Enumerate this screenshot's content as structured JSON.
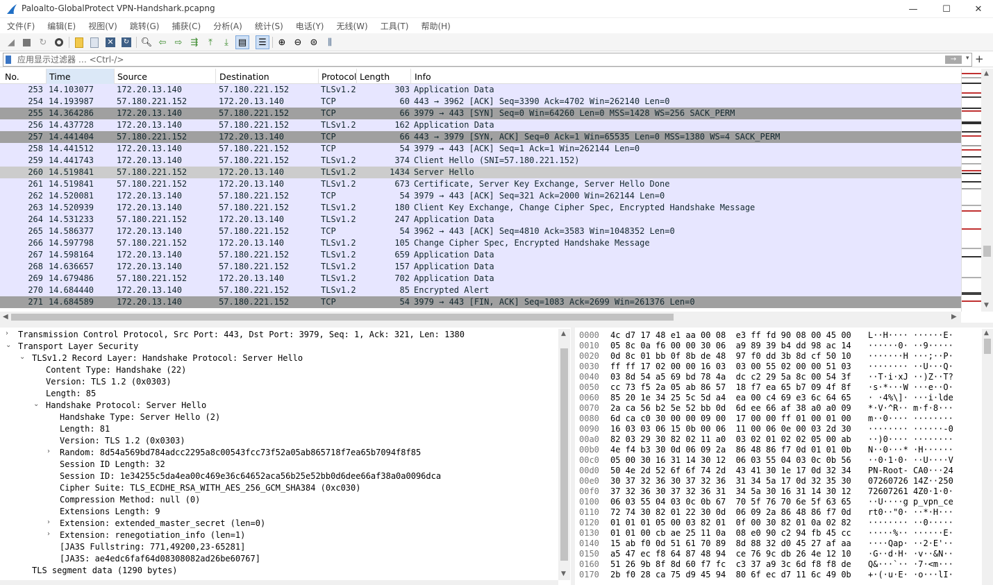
{
  "window": {
    "title": "Paloalto-GlobalProtect VPN-Handshark.pcapng",
    "minimize": "—",
    "maximize": "☐",
    "close": "✕"
  },
  "menu": [
    "文件(F)",
    "编辑(E)",
    "视图(V)",
    "跳转(G)",
    "捕获(C)",
    "分析(A)",
    "统计(S)",
    "电话(Y)",
    "无线(W)",
    "工具(T)",
    "帮助(H)"
  ],
  "filter": {
    "placeholder": "应用显示过滤器 … <Ctrl-/>",
    "apply_label": "→",
    "dropdown": "▾",
    "add_label": "+"
  },
  "packet_list": {
    "columns": [
      "No.",
      "Time",
      "Source",
      "Destination",
      "Protocol",
      "Length",
      "Info"
    ],
    "rows": [
      {
        "no": "253",
        "time": "14.103077",
        "src": "172.20.13.140",
        "dst": "57.180.221.152",
        "proto": "TLSv1.2",
        "len": "303",
        "info": "Application Data",
        "style": "tls"
      },
      {
        "no": "254",
        "time": "14.193987",
        "src": "57.180.221.152",
        "dst": "172.20.13.140",
        "proto": "TCP",
        "len": "60",
        "info": "443 → 3962 [ACK] Seq=3390 Ack=4702 Win=262140 Len=0",
        "style": "tcp"
      },
      {
        "no": "255",
        "time": "14.364286",
        "src": "172.20.13.140",
        "dst": "57.180.221.152",
        "proto": "TCP",
        "len": "66",
        "info": "3979 → 443 [SYN] Seq=0 Win=64260 Len=0 MSS=1428 WS=256 SACK_PERM",
        "style": "syn"
      },
      {
        "no": "256",
        "time": "14.437728",
        "src": "172.20.13.140",
        "dst": "57.180.221.152",
        "proto": "TLSv1.2",
        "len": "162",
        "info": "Application Data",
        "style": "tls"
      },
      {
        "no": "257",
        "time": "14.441404",
        "src": "57.180.221.152",
        "dst": "172.20.13.140",
        "proto": "TCP",
        "len": "66",
        "info": "443 → 3979 [SYN, ACK] Seq=0 Ack=1 Win=65535 Len=0 MSS=1380 WS=4 SACK_PERM",
        "style": "syn"
      },
      {
        "no": "258",
        "time": "14.441512",
        "src": "172.20.13.140",
        "dst": "57.180.221.152",
        "proto": "TCP",
        "len": "54",
        "info": "3979 → 443 [ACK] Seq=1 Ack=1 Win=262144 Len=0",
        "style": "tcp"
      },
      {
        "no": "259",
        "time": "14.441743",
        "src": "172.20.13.140",
        "dst": "57.180.221.152",
        "proto": "TLSv1.2",
        "len": "374",
        "info": "Client Hello (SNI=57.180.221.152)",
        "style": "tls"
      },
      {
        "no": "260",
        "time": "14.519841",
        "src": "57.180.221.152",
        "dst": "172.20.13.140",
        "proto": "TLSv1.2",
        "len": "1434",
        "info": "Server Hello",
        "style": "sel"
      },
      {
        "no": "261",
        "time": "14.519841",
        "src": "57.180.221.152",
        "dst": "172.20.13.140",
        "proto": "TLSv1.2",
        "len": "673",
        "info": "Certificate, Server Key Exchange, Server Hello Done",
        "style": "tls"
      },
      {
        "no": "262",
        "time": "14.520081",
        "src": "172.20.13.140",
        "dst": "57.180.221.152",
        "proto": "TCP",
        "len": "54",
        "info": "3979 → 443 [ACK] Seq=321 Ack=2000 Win=262144 Len=0",
        "style": "tcp"
      },
      {
        "no": "263",
        "time": "14.520939",
        "src": "172.20.13.140",
        "dst": "57.180.221.152",
        "proto": "TLSv1.2",
        "len": "180",
        "info": "Client Key Exchange, Change Cipher Spec, Encrypted Handshake Message",
        "style": "tls"
      },
      {
        "no": "264",
        "time": "14.531233",
        "src": "57.180.221.152",
        "dst": "172.20.13.140",
        "proto": "TLSv1.2",
        "len": "247",
        "info": "Application Data",
        "style": "tls"
      },
      {
        "no": "265",
        "time": "14.586377",
        "src": "172.20.13.140",
        "dst": "57.180.221.152",
        "proto": "TCP",
        "len": "54",
        "info": "3962 → 443 [ACK] Seq=4810 Ack=3583 Win=1048352 Len=0",
        "style": "tcp"
      },
      {
        "no": "266",
        "time": "14.597798",
        "src": "57.180.221.152",
        "dst": "172.20.13.140",
        "proto": "TLSv1.2",
        "len": "105",
        "info": "Change Cipher Spec, Encrypted Handshake Message",
        "style": "tls"
      },
      {
        "no": "267",
        "time": "14.598164",
        "src": "172.20.13.140",
        "dst": "57.180.221.152",
        "proto": "TLSv1.2",
        "len": "659",
        "info": "Application Data",
        "style": "tls"
      },
      {
        "no": "268",
        "time": "14.636657",
        "src": "172.20.13.140",
        "dst": "57.180.221.152",
        "proto": "TLSv1.2",
        "len": "157",
        "info": "Application Data",
        "style": "tls"
      },
      {
        "no": "269",
        "time": "14.679486",
        "src": "57.180.221.152",
        "dst": "172.20.13.140",
        "proto": "TLSv1.2",
        "len": "702",
        "info": "Application Data",
        "style": "tls"
      },
      {
        "no": "270",
        "time": "14.684440",
        "src": "172.20.13.140",
        "dst": "57.180.221.152",
        "proto": "TLSv1.2",
        "len": "85",
        "info": "Encrypted Alert",
        "style": "tls"
      },
      {
        "no": "271",
        "time": "14.684589",
        "src": "172.20.13.140",
        "dst": "57.180.221.152",
        "proto": "TCP",
        "len": "54",
        "info": "3979 → 443 [FIN, ACK] Seq=1083 Ack=2699 Win=261376 Len=0",
        "style": "syn"
      }
    ]
  },
  "details": [
    {
      "indent": 0,
      "toggle": "›",
      "text": "Transmission Control Protocol, Src Port: 443, Dst Port: 3979, Seq: 1, Ack: 321, Len: 1380"
    },
    {
      "indent": 0,
      "toggle": "⌄",
      "text": "Transport Layer Security"
    },
    {
      "indent": 1,
      "toggle": "⌄",
      "text": "TLSv1.2 Record Layer: Handshake Protocol: Server Hello"
    },
    {
      "indent": 2,
      "toggle": "",
      "text": "Content Type: Handshake (22)"
    },
    {
      "indent": 2,
      "toggle": "",
      "text": "Version: TLS 1.2 (0x0303)"
    },
    {
      "indent": 2,
      "toggle": "",
      "text": "Length: 85"
    },
    {
      "indent": 2,
      "toggle": "⌄",
      "text": "Handshake Protocol: Server Hello"
    },
    {
      "indent": 3,
      "toggle": "",
      "text": "Handshake Type: Server Hello (2)"
    },
    {
      "indent": 3,
      "toggle": "",
      "text": "Length: 81"
    },
    {
      "indent": 3,
      "toggle": "",
      "text": "Version: TLS 1.2 (0x0303)"
    },
    {
      "indent": 3,
      "toggle": "›",
      "text": "Random: 8d54a569bd784adcc2295a8c00543fcc73f52a05ab865718f7ea65b7094f8f85"
    },
    {
      "indent": 3,
      "toggle": "",
      "text": "Session ID Length: 32"
    },
    {
      "indent": 3,
      "toggle": "",
      "text": "Session ID: 1e34255c5da4ea00c469e36c64652aca56b25e52bb0d6dee66af38a0a0096dca"
    },
    {
      "indent": 3,
      "toggle": "",
      "text": "Cipher Suite: TLS_ECDHE_RSA_WITH_AES_256_GCM_SHA384 (0xc030)"
    },
    {
      "indent": 3,
      "toggle": "",
      "text": "Compression Method: null (0)"
    },
    {
      "indent": 3,
      "toggle": "",
      "text": "Extensions Length: 9"
    },
    {
      "indent": 3,
      "toggle": "›",
      "text": "Extension: extended_master_secret (len=0)"
    },
    {
      "indent": 3,
      "toggle": "›",
      "text": "Extension: renegotiation_info (len=1)"
    },
    {
      "indent": 3,
      "toggle": "",
      "text": "[JA3S Fullstring: 771,49200,23-65281]"
    },
    {
      "indent": 3,
      "toggle": "",
      "text": "[JA3S: ae4edc6faf64d08308082ad26be60767]"
    },
    {
      "indent": 1,
      "toggle": "",
      "text": "TLS segment data (1290 bytes)"
    }
  ],
  "bytes": [
    {
      "off": "0000",
      "hex": "4c d7 17 48 e1 aa 00 08  e3 ff fd 90 08 00 45 00",
      "ascii": "L··H···· ······E·"
    },
    {
      "off": "0010",
      "hex": "05 8c 0a f6 00 00 30 06  a9 89 39 b4 dd 98 ac 14",
      "ascii": "······0· ··9·····"
    },
    {
      "off": "0020",
      "hex": "0d 8c 01 bb 0f 8b de 48  97 f0 dd 3b 8d cf 50 10",
      "ascii": "·······H ···;··P·"
    },
    {
      "off": "0030",
      "hex": "ff ff 17 02 00 00 16 03  03 00 55 02 00 00 51 03",
      "ascii": "········ ··U···Q·"
    },
    {
      "off": "0040",
      "hex": "03 8d 54 a5 69 bd 78 4a  dc c2 29 5a 8c 00 54 3f",
      "ascii": "··T·i·xJ ··)Z··T?"
    },
    {
      "off": "0050",
      "hex": "cc 73 f5 2a 05 ab 86 57  18 f7 ea 65 b7 09 4f 8f",
      "ascii": "·s·*···W ···e··O·"
    },
    {
      "off": "0060",
      "hex": "85 20 1e 34 25 5c 5d a4  ea 00 c4 69 e3 6c 64 65",
      "ascii": "· ·4%\\]· ···i·lde"
    },
    {
      "off": "0070",
      "hex": "2a ca 56 b2 5e 52 bb 0d  6d ee 66 af 38 a0 a0 09",
      "ascii": "*·V·^R·· m·f·8···"
    },
    {
      "off": "0080",
      "hex": "6d ca c0 30 00 00 09 00  17 00 00 ff 01 00 01 00",
      "ascii": "m··0···· ········"
    },
    {
      "off": "0090",
      "hex": "16 03 03 06 15 0b 00 06  11 00 06 0e 00 03 2d 30",
      "ascii": "········ ······-0"
    },
    {
      "off": "00a0",
      "hex": "82 03 29 30 82 02 11 a0  03 02 01 02 02 05 00 ab",
      "ascii": "··)0···· ········"
    },
    {
      "off": "00b0",
      "hex": "4e f4 b3 30 0d 06 09 2a  86 48 86 f7 0d 01 01 0b",
      "ascii": "N··0···* ·H······"
    },
    {
      "off": "00c0",
      "hex": "05 00 30 16 31 14 30 12  06 03 55 04 03 0c 0b 56",
      "ascii": "··0·1·0· ··U····V"
    },
    {
      "off": "00d0",
      "hex": "50 4e 2d 52 6f 6f 74 2d  43 41 30 1e 17 0d 32 34",
      "ascii": "PN-Root- CA0···24"
    },
    {
      "off": "00e0",
      "hex": "30 37 32 36 30 37 32 36  31 34 5a 17 0d 32 35 30",
      "ascii": "07260726 14Z··250"
    },
    {
      "off": "00f0",
      "hex": "37 32 36 30 37 32 36 31  34 5a 30 16 31 14 30 12",
      "ascii": "72607261 4Z0·1·0·"
    },
    {
      "off": "0100",
      "hex": "06 03 55 04 03 0c 0b 67  70 5f 76 70 6e 5f 63 65",
      "ascii": "··U····g p_vpn_ce"
    },
    {
      "off": "0110",
      "hex": "72 74 30 82 01 22 30 0d  06 09 2a 86 48 86 f7 0d",
      "ascii": "rt0··\"0· ··*·H···"
    },
    {
      "off": "0120",
      "hex": "01 01 01 05 00 03 82 01  0f 00 30 82 01 0a 02 82",
      "ascii": "········ ··0·····"
    },
    {
      "off": "0130",
      "hex": "01 01 00 cb ae 25 11 0a  08 e0 90 c2 94 fb 45 cc",
      "ascii": "·····%·· ······E·"
    },
    {
      "off": "0140",
      "hex": "15 ab f0 0d 51 61 70 89  8d 88 32 d0 45 27 af aa",
      "ascii": "····Qap· ··2·E'··"
    },
    {
      "off": "0150",
      "hex": "a5 47 ec f8 64 87 48 94  ce 76 9c db 26 4e 12 10",
      "ascii": "·G··d·H· ·v··&N··"
    },
    {
      "off": "0160",
      "hex": "51 26 9b 8f 8d 60 f7 fc  c3 37 a9 3c 6d f8 f8 de",
      "ascii": "Q&···`·· ·7·<m···"
    },
    {
      "off": "0170",
      "hex": "2b f0 28 ca 75 d9 45 94  80 6f ec d7 11 6c 49 0b",
      "ascii": "+·(·u·E· ·o···lI·"
    }
  ],
  "colors": {
    "tcp_row": "#e7e6ff",
    "syn_row": "#a0a0a0",
    "selected_row": "#cccccc",
    "header_sorted": "#dbe8f7"
  }
}
